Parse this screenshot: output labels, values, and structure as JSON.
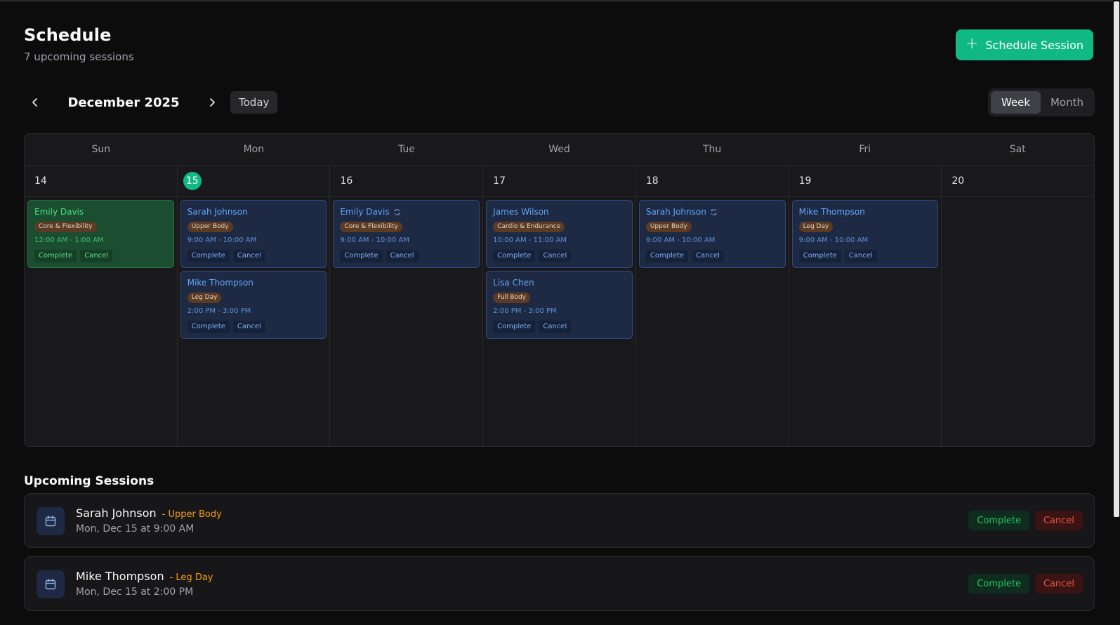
{
  "header": {
    "title": "Schedule",
    "subtitle": "7 upcoming sessions",
    "schedule_button": "Schedule Session"
  },
  "nav": {
    "month": "December 2025",
    "today": "Today"
  },
  "view_toggle": {
    "week": "Week",
    "month": "Month",
    "active": "Week"
  },
  "calendar": {
    "weekdays": [
      "Sun",
      "Mon",
      "Tue",
      "Wed",
      "Thu",
      "Fri",
      "Sat"
    ],
    "days": [
      {
        "num": "14",
        "today": false,
        "events": [
          {
            "name": "Emily Davis",
            "type": "Core & Flexibility",
            "time": "12:00 AM - 1:00 AM",
            "complete": "Complete",
            "cancel": "Cancel",
            "status": "completed",
            "recurring": false
          }
        ]
      },
      {
        "num": "15",
        "today": true,
        "events": [
          {
            "name": "Sarah Johnson",
            "type": "Upper Body",
            "time": "9:00 AM - 10:00 AM",
            "complete": "Complete",
            "cancel": "Cancel",
            "status": "scheduled",
            "recurring": false
          },
          {
            "name": "Mike Thompson",
            "type": "Leg Day",
            "time": "2:00 PM - 3:00 PM",
            "complete": "Complete",
            "cancel": "Cancel",
            "status": "scheduled",
            "recurring": false
          }
        ]
      },
      {
        "num": "16",
        "today": false,
        "events": [
          {
            "name": "Emily Davis",
            "type": "Core & Flexibility",
            "time": "9:00 AM - 10:00 AM",
            "complete": "Complete",
            "cancel": "Cancel",
            "status": "scheduled",
            "recurring": true
          }
        ]
      },
      {
        "num": "17",
        "today": false,
        "events": [
          {
            "name": "James Wilson",
            "type": "Cardio & Endurance",
            "time": "10:00 AM - 11:00 AM",
            "complete": "Complete",
            "cancel": "Cancel",
            "status": "scheduled",
            "recurring": false
          },
          {
            "name": "Lisa Chen",
            "type": "Full Body",
            "time": "2:00 PM - 3:00 PM",
            "complete": "Complete",
            "cancel": "Cancel",
            "status": "scheduled",
            "recurring": false
          }
        ]
      },
      {
        "num": "18",
        "today": false,
        "events": [
          {
            "name": "Sarah Johnson",
            "type": "Upper Body",
            "time": "9:00 AM - 10:00 AM",
            "complete": "Complete",
            "cancel": "Cancel",
            "status": "scheduled",
            "recurring": true
          }
        ]
      },
      {
        "num": "19",
        "today": false,
        "events": [
          {
            "name": "Mike Thompson",
            "type": "Leg Day",
            "time": "9:00 AM - 10:00 AM",
            "complete": "Complete",
            "cancel": "Cancel",
            "status": "scheduled",
            "recurring": false
          }
        ]
      },
      {
        "num": "20",
        "today": false,
        "events": []
      }
    ]
  },
  "upcoming": {
    "title": "Upcoming Sessions",
    "items": [
      {
        "name": "Sarah Johnson",
        "type": "- Upper Body",
        "when": "Mon, Dec 15 at 9:00 AM",
        "complete": "Complete",
        "cancel": "Cancel"
      },
      {
        "name": "Mike Thompson",
        "type": "- Leg Day",
        "when": "Mon, Dec 15 at 2:00 PM",
        "complete": "Complete",
        "cancel": "Cancel"
      }
    ]
  },
  "colors": {
    "accent": "#10b981",
    "background": "#0c0c0d",
    "event_blue": "#60a5fa",
    "event_done_green": "#4ade80",
    "tag_brown": "#5b3b24",
    "type_orange": "#f59e0b",
    "cancel_red": "#f05252"
  },
  "icons": {
    "schedule_button": "plus-icon",
    "prev": "chevron-left-icon",
    "next": "chevron-right-icon",
    "recurring": "refresh-icon",
    "session": "calendar-icon"
  }
}
